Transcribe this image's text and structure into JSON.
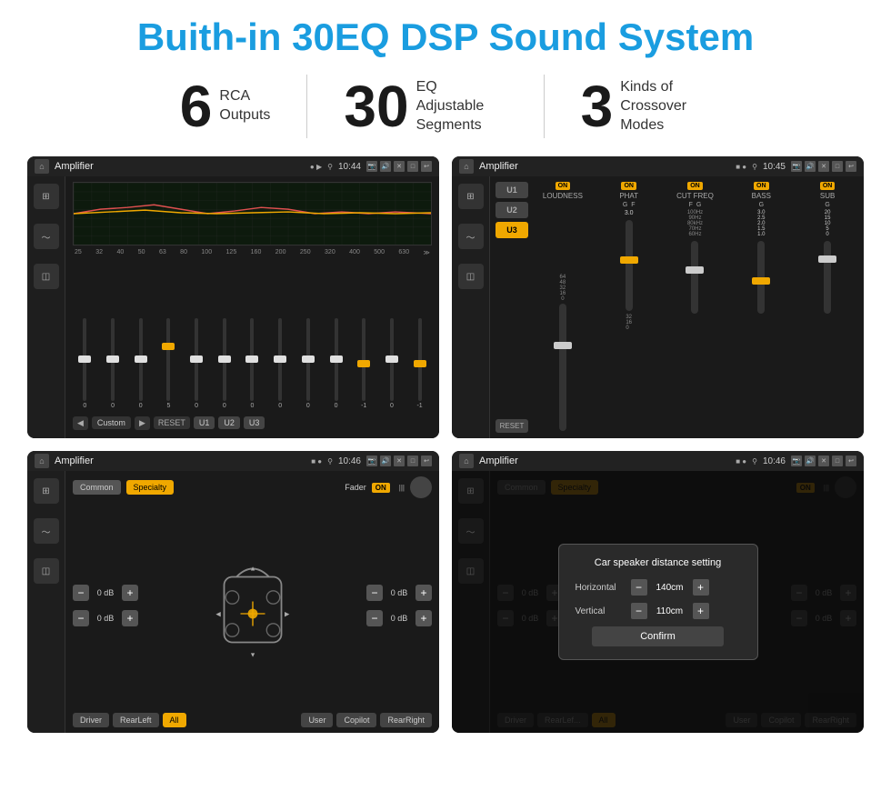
{
  "page": {
    "title": "Buith-in 30EQ DSP Sound System",
    "title_color": "#1a9de0"
  },
  "stats": [
    {
      "number": "6",
      "label": "RCA\nOutputs"
    },
    {
      "number": "30",
      "label": "EQ Adjustable\nSegments"
    },
    {
      "number": "3",
      "label": "Kinds of\nCrossover Modes"
    }
  ],
  "screens": [
    {
      "id": "eq-screen",
      "status_bar": {
        "title": "Amplifier",
        "time": "10:44"
      },
      "type": "equalizer"
    },
    {
      "id": "crossover-screen",
      "status_bar": {
        "title": "Amplifier",
        "time": "10:45"
      },
      "type": "crossover"
    },
    {
      "id": "fader-screen",
      "status_bar": {
        "title": "Amplifier",
        "time": "10:46"
      },
      "type": "fader"
    },
    {
      "id": "distance-screen",
      "status_bar": {
        "title": "Amplifier",
        "time": "10:46"
      },
      "type": "distance"
    }
  ],
  "eq": {
    "frequencies": [
      "25",
      "32",
      "40",
      "50",
      "63",
      "80",
      "100",
      "125",
      "160",
      "200",
      "250",
      "320",
      "400",
      "500",
      "630"
    ],
    "values": [
      "0",
      "0",
      "0",
      "5",
      "0",
      "0",
      "0",
      "0",
      "0",
      "0",
      "0",
      "-1",
      "0",
      "-1"
    ],
    "presets": [
      "Custom",
      "RESET",
      "U1",
      "U2",
      "U3"
    ]
  },
  "crossover": {
    "presets": [
      "U1",
      "U2",
      "U3"
    ],
    "channels": [
      {
        "name": "LOUDNESS",
        "on": true
      },
      {
        "name": "PHAT",
        "on": true
      },
      {
        "name": "CUT FREQ",
        "on": true
      },
      {
        "name": "BASS",
        "on": true
      },
      {
        "name": "SUB",
        "on": true
      }
    ]
  },
  "fader": {
    "tabs": [
      "Common",
      "Specialty"
    ],
    "active_tab": "Specialty",
    "fader_label": "Fader",
    "on_label": "ON",
    "controls": [
      {
        "label": "0 dB"
      },
      {
        "label": "0 dB"
      },
      {
        "label": "0 dB"
      },
      {
        "label": "0 dB"
      }
    ],
    "bottom_buttons": [
      "Driver",
      "RearLeft",
      "All",
      "User",
      "Copilot",
      "RearRight"
    ]
  },
  "distance": {
    "modal": {
      "title": "Car speaker distance setting",
      "horizontal_label": "Horizontal",
      "horizontal_value": "140cm",
      "vertical_label": "Vertical",
      "vertical_value": "110cm",
      "confirm_label": "Confirm"
    },
    "tabs": [
      "Common",
      "Specialty"
    ],
    "bottom_buttons": [
      "Driver",
      "RearLeft",
      "All",
      "User",
      "Copilot",
      "RearRight"
    ]
  }
}
